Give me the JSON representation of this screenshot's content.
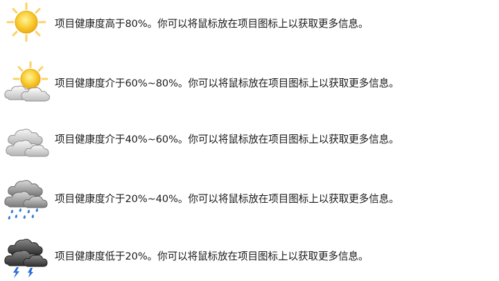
{
  "weather_legend": {
    "items": [
      {
        "icon": "sunny-icon",
        "text": "项目健康度高于80%。你可以将鼠标放在项目图标上以获取更多信息。"
      },
      {
        "icon": "partly-cloudy-icon",
        "text": "项目健康度介于60%~80%。你可以将鼠标放在项目图标上以获取更多信息。"
      },
      {
        "icon": "cloudy-icon",
        "text": "项目健康度介于40%~60%。你可以将鼠标放在项目图标上以获取更多信息。"
      },
      {
        "icon": "rain-icon",
        "text": "项目健康度介于20%~40%。你可以将鼠标放在项目图标上以获取更多信息。"
      },
      {
        "icon": "thunderstorm-icon",
        "text": "项目健康度低于20%。你可以将鼠标放在项目图标上以获取更多信息。"
      }
    ]
  },
  "colors": {
    "sun": "#f7c31f",
    "cloud": "#d4d4d4",
    "storm_cloud": "#4a4a4a",
    "rain": "#3a7bd5",
    "lightning": "#2b6fd6"
  }
}
